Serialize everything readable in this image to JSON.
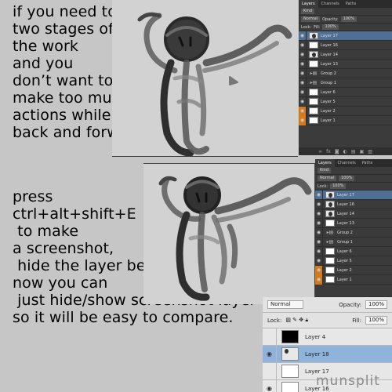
{
  "tip_top": {
    "lines": [
      "if you need to compare",
      "two stages of",
      "the work",
      "and you",
      "don’t want to",
      "make too much",
      "actions while going",
      "back and forward"
    ]
  },
  "tip_bottom": {
    "lines": [
      "press",
      "ctrl+alt+shift+E",
      " to make",
      "a screenshot,",
      " hide the layer between,",
      "now you can",
      " just hide/show screenshot layer",
      "so it will be easy to compare."
    ]
  },
  "panel_small": {
    "tabs": [
      "Layers",
      "Channels",
      "Paths"
    ],
    "kind": "Kind",
    "blend_mode": "Normal",
    "opacity_label": "Opacity:",
    "opacity_value": "100%",
    "lock_label": "Lock:",
    "fill_label": "Fill:",
    "fill_value": "100%",
    "layers": [
      {
        "name": "Layer 17",
        "type": "layer"
      },
      {
        "name": "Layer 16",
        "type": "layer"
      },
      {
        "name": "Layer 14",
        "type": "layer"
      },
      {
        "name": "Layer 13",
        "type": "layer"
      },
      {
        "name": "Group 2",
        "type": "group"
      },
      {
        "name": "Group 1",
        "type": "group"
      },
      {
        "name": "Layer 6",
        "type": "layer"
      },
      {
        "name": "Layer 5",
        "type": "layer"
      },
      {
        "name": "Layer 2",
        "type": "layer"
      },
      {
        "name": "Layer 1",
        "type": "layer"
      }
    ],
    "footer_icons": [
      "link-icon",
      "fx-icon",
      "mask-icon",
      "adjustment-icon",
      "folder-icon",
      "new-layer-icon",
      "trash-icon"
    ]
  },
  "panel_large": {
    "blend_mode": "Normal",
    "opacity_label": "Opacity:",
    "opacity_value": "100%",
    "lock_label": "Lock:",
    "fill_label": "Fill:",
    "fill_value": "100%",
    "layers": [
      {
        "name": "Layer 4",
        "visible": false,
        "thumb": "black"
      },
      {
        "name": "Layer 18",
        "visible": true,
        "thumb": "sketch"
      },
      {
        "name": "Layer 17",
        "visible": false,
        "thumb": "white"
      },
      {
        "name": "Layer 16",
        "visible": true,
        "thumb": "white"
      }
    ]
  },
  "watermark": "munsplit",
  "colors": {
    "background": "#c6c6c6",
    "panel_dark": "#3b3b3b",
    "selected_dark": "#4f6f95",
    "selected_light": "#8fb3da",
    "eye_orange": "#d57a1a"
  }
}
